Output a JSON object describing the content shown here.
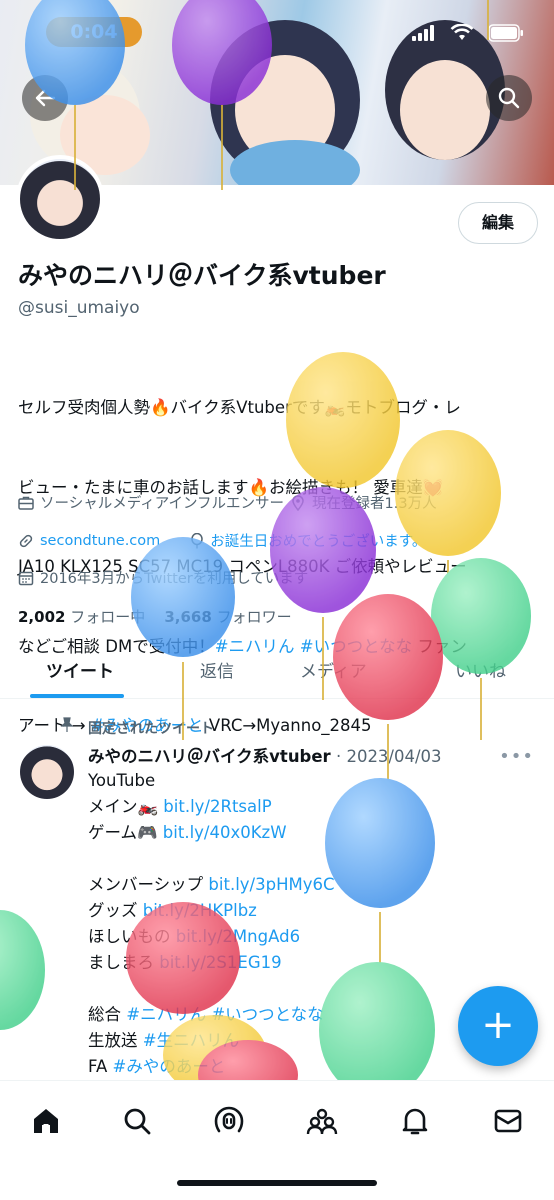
{
  "status_bar": {
    "timer": "0:04"
  },
  "profile": {
    "edit_label": "編集",
    "display_name": "みやのニハリ＠バイク系vtuber",
    "handle": "@susi_umaiyo",
    "bio_lines": [
      "セルフ受肉個人勢🔥バイク系Vtuberです🏍️モトブログ・レ",
      "ビュー・たまに車のお話します🔥お絵描きも！ 愛車達💓",
      "JA10 KLX125 SC57 MC19 コペンL880K ご依頼やレビュー",
      "などご相談 DMで受付中！",
      "アート → ",
      " VRC→Myanno_2845"
    ],
    "bio_tags": [
      "#ニハリん",
      "#いつつとなな",
      "ファン",
      "#みやのあーと"
    ],
    "category": "ソーシャルメディアインフルエンサー",
    "location": "現在登録者1.3万人",
    "website": "secondtune.com",
    "birthday": "お誕生日おめでとうございます。",
    "joined": "2016年3月からTwitterを利用しています",
    "following_count": "2,002",
    "following_label": "フォロー中",
    "followers_count": "3,668",
    "followers_label": "フォロワー"
  },
  "tabs": [
    "ツイート",
    "返信",
    "メディア",
    "いいね"
  ],
  "pinned": {
    "label": "固定されたツイート",
    "author": "みやのニハリ＠バイク系vtuber",
    "date": "· 2023/04/03",
    "lines": [
      {
        "text": "YouTube",
        "link": ""
      },
      {
        "text": " メイン🏍️ ",
        "link": "bit.ly/2RtsalP"
      },
      {
        "text": " ゲーム🎮 ",
        "link": "bit.ly/40x0KzW"
      },
      {
        "text": "",
        "link": ""
      },
      {
        "text": "メンバーシップ ",
        "link": "bit.ly/3pHMy6C"
      },
      {
        "text": "グッズ ",
        "link": "bit.ly/2HKPlbz"
      },
      {
        "text": "ほしいもの ",
        "link": "bit.ly/2MngAd6"
      },
      {
        "text": "ましまろ ",
        "link": "bit.ly/2S1EG19"
      },
      {
        "text": "",
        "link": ""
      },
      {
        "text": "総合 ",
        "link": "#ニハリん #いつつとなな"
      },
      {
        "text": "生放送 ",
        "link": "#生ニハリん"
      },
      {
        "text": "FA ",
        "link": "#みやのあーと"
      }
    ]
  },
  "fab_label": "+",
  "nav": [
    "home-icon",
    "search-icon",
    "spaces-icon",
    "communities-icon",
    "notifications-icon",
    "messages-icon"
  ],
  "colors": {
    "accent": "#1d9bf0",
    "timer": "#e59a2d"
  }
}
